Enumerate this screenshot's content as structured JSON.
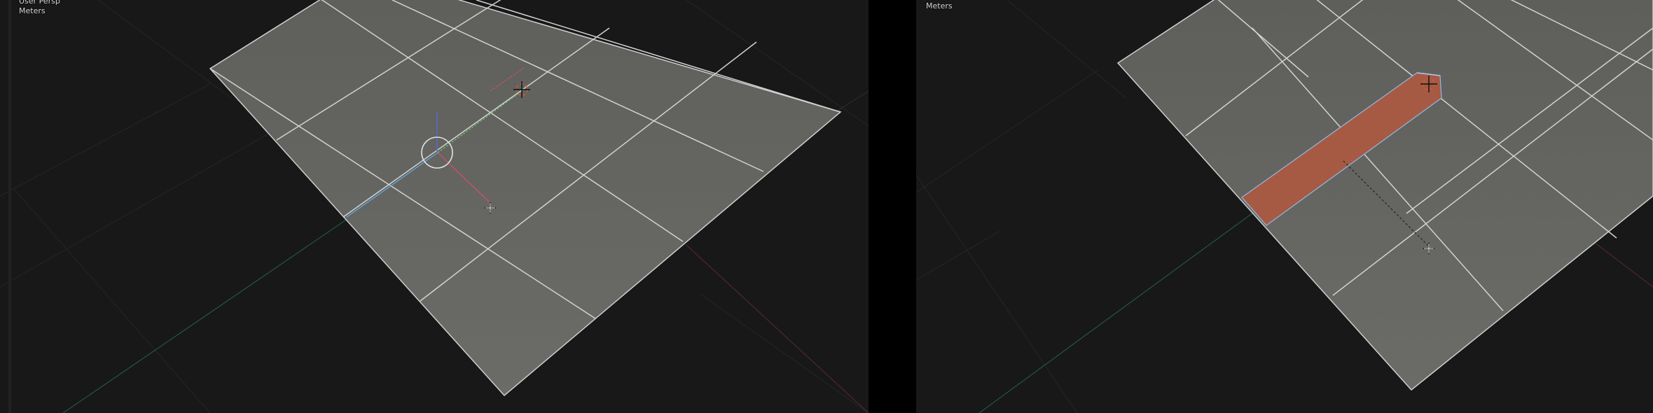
{
  "left_viewport": {
    "view_name": "User Persp",
    "unit_label": "Meters"
  },
  "right_viewport": {
    "unit_label": "Meters"
  },
  "icons": {
    "gizmo": "transform-gizmo-icon",
    "cursor3d": "3d-cursor-icon",
    "mouse": "move-cursor-icon"
  },
  "colors": {
    "background": "#181818",
    "plane": "#6a6a66",
    "wire": "#d0d0d0",
    "selected_face": "#a65a43",
    "selected_edge": "#8fb3d9",
    "axis_x": "#d0506a",
    "axis_y": "#6cc06a",
    "axis_z": "#5a6ad8",
    "floor_grid": "#2e2e2e"
  }
}
